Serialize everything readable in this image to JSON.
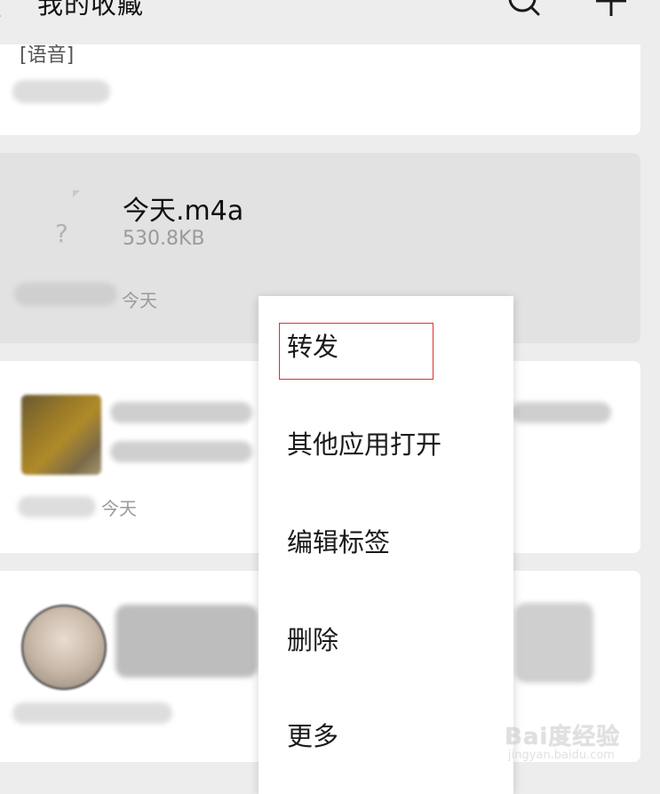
{
  "header": {
    "title": "我的收藏"
  },
  "items": {
    "voice": {
      "label": "[语音]"
    },
    "audio": {
      "file_name": "今天.m4a",
      "file_size": "530.8KB",
      "date": "今天",
      "file_icon_glyph": "?"
    },
    "link": {
      "date": "今天"
    }
  },
  "context_menu": {
    "items": [
      {
        "label": "转发"
      },
      {
        "label": "其他应用打开"
      },
      {
        "label": "编辑标签"
      },
      {
        "label": "删除"
      },
      {
        "label": "更多"
      }
    ],
    "highlighted_index": 0,
    "highlight_color": "#e03030"
  },
  "watermark": {
    "main": "Bai度经验",
    "sub": "jingyan.baidu.com"
  },
  "icons": {
    "back": "chevron-left-icon",
    "search": "search-icon",
    "add": "plus-icon"
  }
}
